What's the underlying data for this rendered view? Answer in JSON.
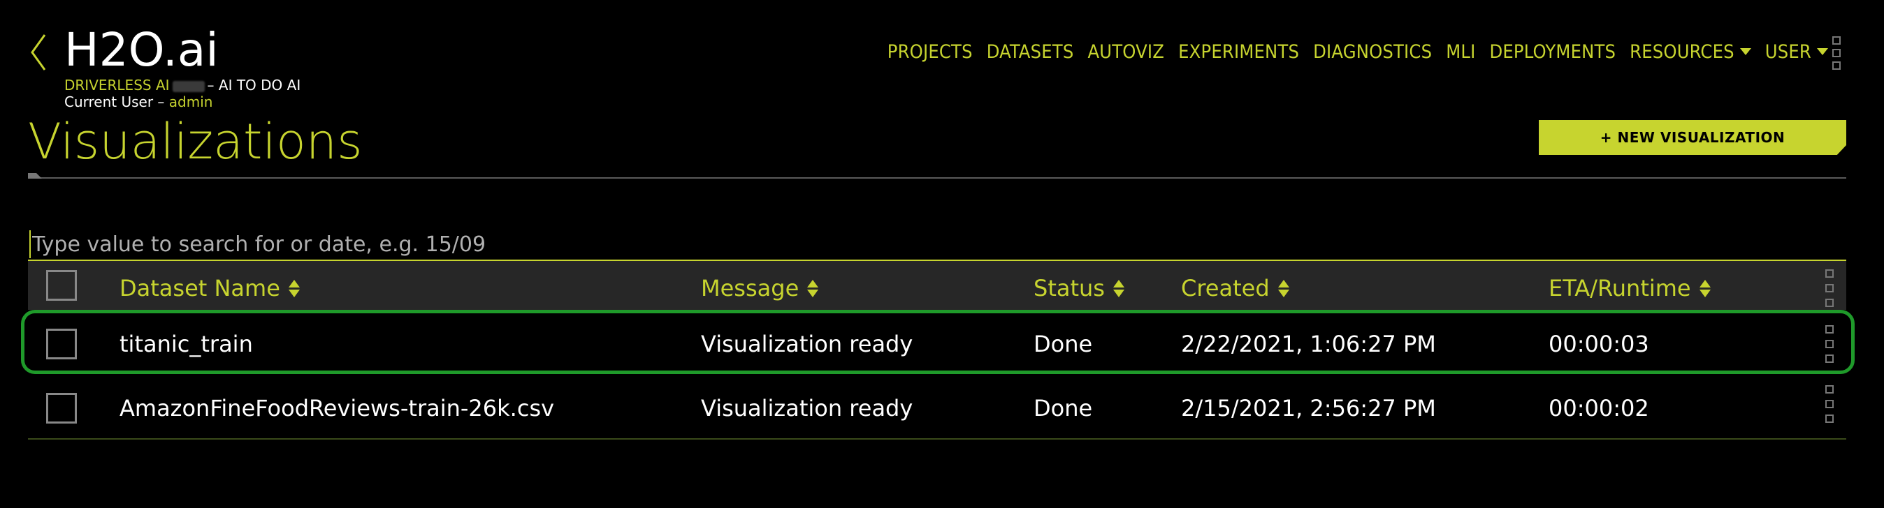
{
  "brand": {
    "title": "H2O.ai",
    "product": "DRIVERLESS AI",
    "tagline": "– AI TO DO AI",
    "current_user_label": "Current User –",
    "current_user": "admin"
  },
  "nav": {
    "items": [
      "PROJECTS",
      "DATASETS",
      "AUTOVIZ",
      "EXPERIMENTS",
      "DIAGNOSTICS",
      "MLI",
      "DEPLOYMENTS"
    ],
    "resources": "RESOURCES",
    "user": "USER"
  },
  "page": {
    "title": "Visualizations",
    "new_button": "+ NEW VISUALIZATION"
  },
  "search": {
    "placeholder": "Type value to search for or date, e.g. 15/09",
    "value": ""
  },
  "table": {
    "columns": [
      "Dataset Name",
      "Message",
      "Status",
      "Created",
      "ETA/Runtime"
    ],
    "rows": [
      {
        "dataset": "titanic_train",
        "message": "Visualization ready",
        "status": "Done",
        "created": "2/22/2021, 1:06:27 PM",
        "runtime": "00:00:03",
        "highlighted": true
      },
      {
        "dataset": "AmazonFineFoodReviews-train-26k.csv",
        "message": "Visualization ready",
        "status": "Done",
        "created": "2/15/2021, 2:56:27 PM",
        "runtime": "00:00:02",
        "highlighted": false
      }
    ]
  },
  "colors": {
    "accent": "#c7d42f",
    "background": "#000000",
    "highlight": "#1f9a2a",
    "header_row": "#272727"
  }
}
